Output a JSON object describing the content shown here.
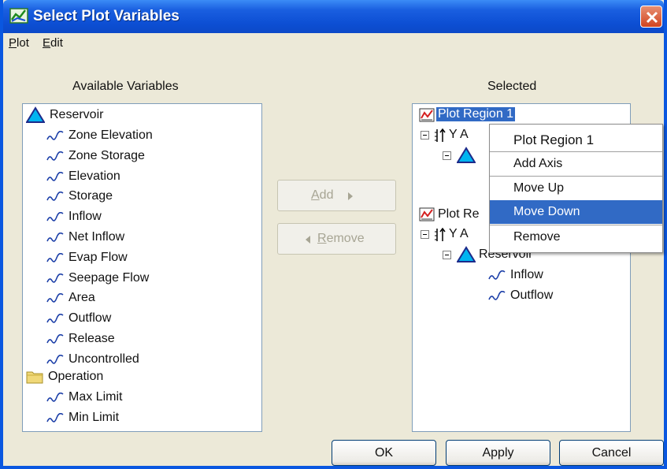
{
  "window": {
    "title": "Select Plot Variables"
  },
  "menu": {
    "items": [
      "Plot",
      "Edit"
    ]
  },
  "available": {
    "header": "Available Variables",
    "groups": [
      {
        "label": "Reservoir",
        "icon": "triangle-icon",
        "items": [
          "Zone Elevation",
          "Zone Storage",
          "Elevation",
          "Storage",
          "Inflow",
          "Net Inflow",
          "Evap Flow",
          "Seepage Flow",
          "Area",
          "Outflow",
          "Release",
          "Uncontrolled"
        ]
      },
      {
        "label": "Operation",
        "icon": "folder-icon",
        "items": [
          "Max Limit",
          "Min Limit"
        ]
      }
    ]
  },
  "buttons": {
    "add_prefix": "",
    "add_mnemonic": "A",
    "add_rest": "dd",
    "remove_mnemonic": "R",
    "remove_rest": "emove",
    "ok": "OK",
    "apply": "Apply",
    "cancel": "Cancel"
  },
  "selected": {
    "header": "Selected",
    "region1": {
      "label": "Plot Region 1",
      "axis_label": "Y A­x"
    },
    "region2": {
      "label": "Plot Re",
      "axis_label": "Y A",
      "group_label": "Reservoir",
      "items": [
        "Inflow",
        "Outflow"
      ]
    }
  },
  "context_menu": {
    "header": "Plot Region 1",
    "items": [
      "Add Axis",
      "Move Up",
      "Move Down",
      "Remove"
    ],
    "active_item": "Move Down"
  },
  "colors": {
    "title_bar": "#0d4fd4",
    "selection": "#316ac5",
    "reservoir_triangle": "#00b4f0"
  }
}
